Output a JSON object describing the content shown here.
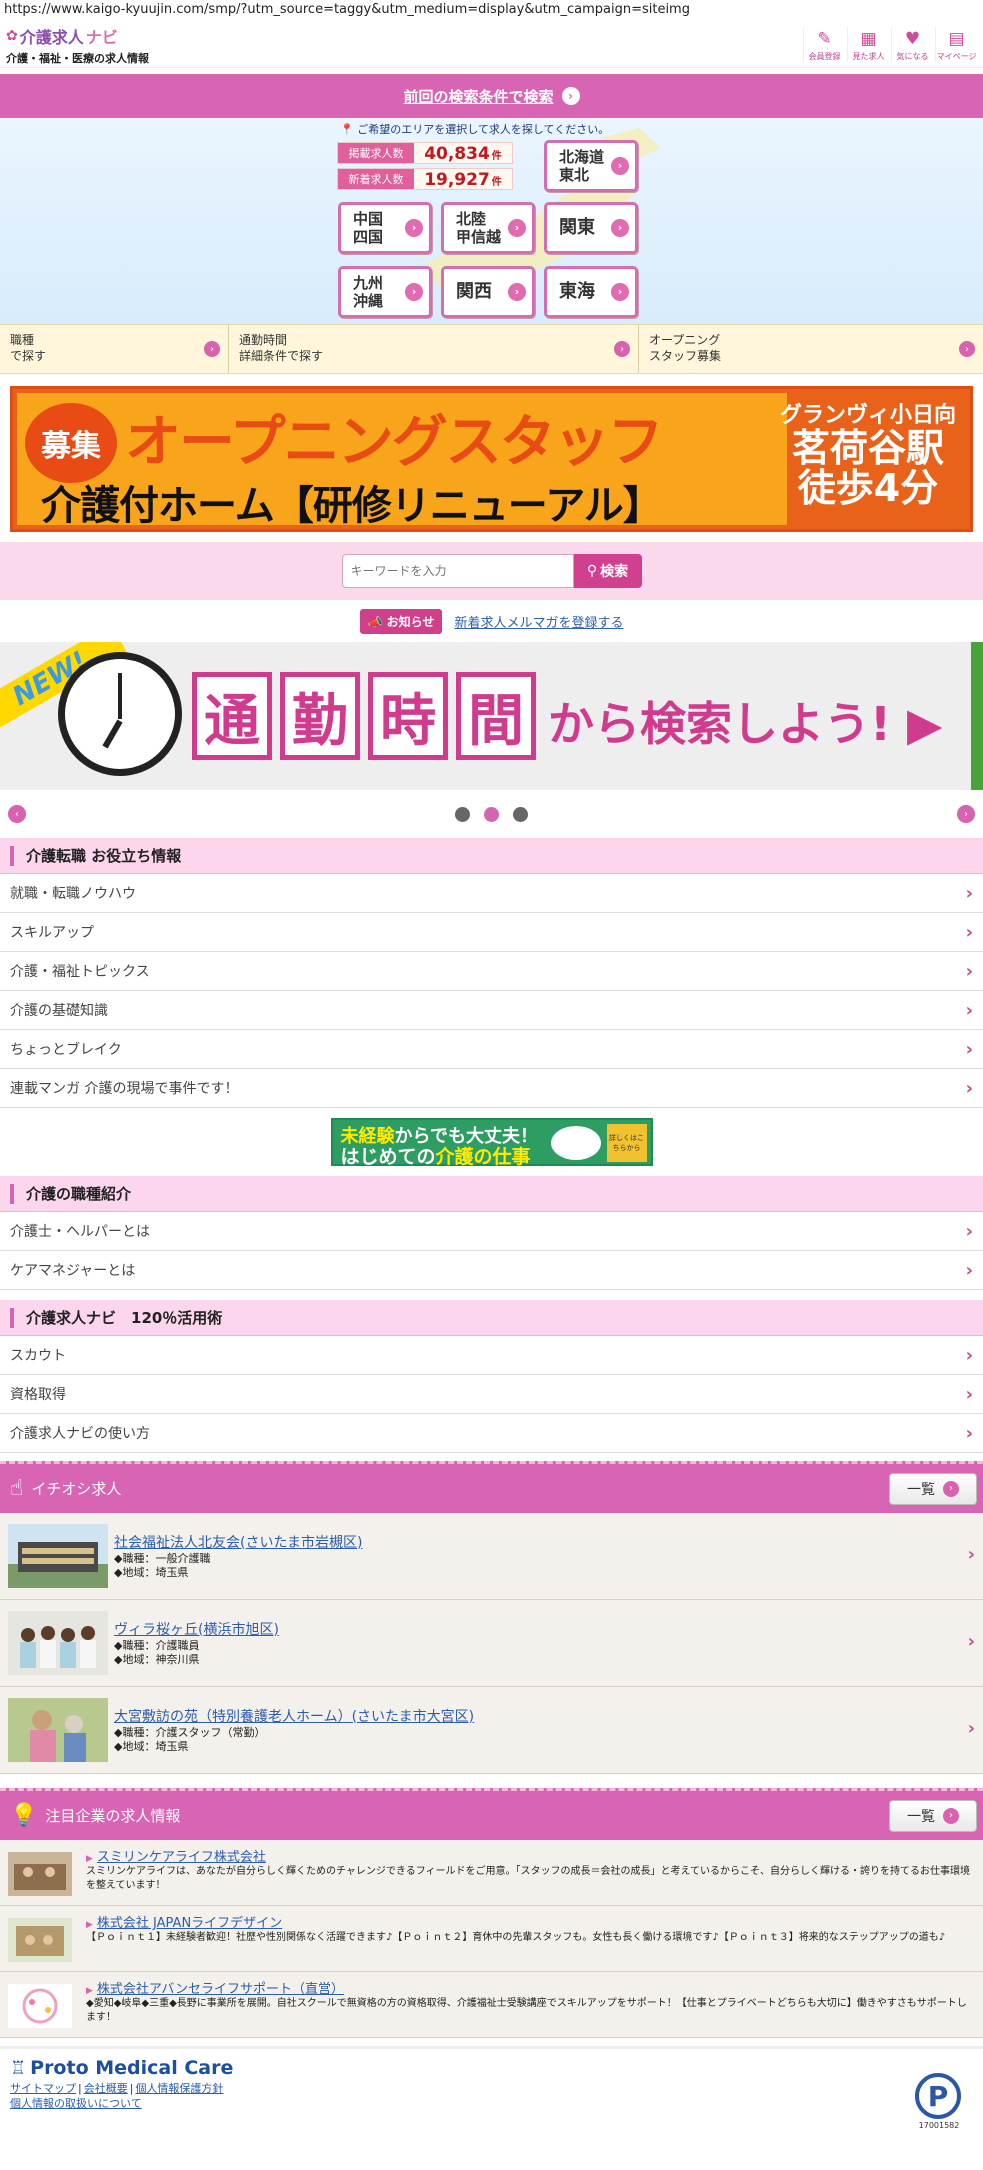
{
  "browser": {
    "url": "https://www.kaigo-kyuujin.com/smp/?utm_source=taggy&utm_medium=display&utm_campaign=siteimg"
  },
  "header": {
    "logo_main": "介護求人",
    "logo_navi": "ナビ",
    "logo_sub": "介護・福祉・医療の求人情報",
    "icons": [
      {
        "label": "会員登録",
        "icon": "pencil-icon"
      },
      {
        "label": "見た求人",
        "icon": "calendar-icon"
      },
      {
        "label": "気になる",
        "icon": "heart-icon"
      },
      {
        "label": "マイページ",
        "icon": "mypage-icon"
      }
    ]
  },
  "prev_search": {
    "label": "前回の検索条件で検索"
  },
  "map": {
    "hint": "ご希望のエリアを選択して求人を探してください。",
    "counts": [
      {
        "tag": "掲載求人数",
        "value": "40,834",
        "unit": "件"
      },
      {
        "tag": "新着求人数",
        "value": "19,927",
        "unit": "件"
      }
    ],
    "regions": {
      "hokkaido": {
        "line1": "北海道",
        "line2": "東北"
      },
      "chugoku": {
        "line1": "中国",
        "line2": "四国"
      },
      "hokuriku": {
        "line1": "北陸",
        "line2": "甲信越"
      },
      "kanto": "関東",
      "kyushu": {
        "line1": "九州",
        "line2": "沖縄"
      },
      "kansai": "関西",
      "tokai": "東海"
    }
  },
  "quick_links": [
    {
      "line1": "職種",
      "line2": "で探す"
    },
    {
      "line1": "通勤時間",
      "line2": "詳細条件で探す"
    },
    {
      "line1": "オープニング",
      "line2": "スタッフ募集"
    }
  ],
  "banner1": {
    "badge": "募集",
    "title": "オープニングスタッフ",
    "subtitle": "介護付ホーム【研修リニューアル】",
    "right_line1": "グランヴィ小日向",
    "right_line2": "茗荷谷駅",
    "right_line3": "徒歩4分"
  },
  "search": {
    "placeholder": "キーワードを入力",
    "button": "検索"
  },
  "notice": {
    "badge": "お知らせ",
    "link": "新着求人メルマガを登録する"
  },
  "banner2": {
    "ribbon": "NEW!",
    "boxes": [
      "通",
      "勤",
      "時",
      "間"
    ],
    "tail": "から検索しよう!"
  },
  "slider": {
    "dots": 3,
    "active": 1
  },
  "sections": [
    {
      "title": "介護転職 お役立ち情報",
      "items": [
        "就職・転職ノウハウ",
        "スキルアップ",
        "介護・福祉トピックス",
        "介護の基礎知識",
        "ちょっとブレイク",
        "連載マンガ 介護の現場で事件です！"
      ]
    },
    {
      "title": "介護の職種紹介",
      "items": [
        "介護士・ヘルパーとは",
        "ケアマネジャーとは"
      ]
    },
    {
      "title": "介護求人ナビ　120％活用術",
      "items": [
        "スカウト",
        "資格取得",
        "介護求人ナビの使い方"
      ]
    }
  ],
  "banner3": {
    "l1_hl": "未経験",
    "l1": "からでも大丈夫！",
    "l2a": "はじめての",
    "l2_hl": "介護の仕事",
    "badge": "詳しくはこちらから"
  },
  "pickup": {
    "title": "イチオシ求人",
    "list_button": "一覧",
    "jobs": [
      {
        "name": "社会福祉法人北友会(さいたま市岩槻区)",
        "job": "◆職種：一般介護職",
        "area": "◆地域：埼玉県"
      },
      {
        "name": "ヴィラ桜ヶ丘(横浜市旭区)",
        "job": "◆職種：介護職員",
        "area": "◆地域：神奈川県"
      },
      {
        "name": "大宮敷訪の苑（特別養護老人ホーム）(さいたま市大宮区)",
        "job": "◆職種：介護スタッフ（常勤）",
        "area": "◆地域：埼玉県"
      }
    ]
  },
  "companies": {
    "title": "注目企業の求人情報",
    "list_button": "一覧",
    "items": [
      {
        "name": "スミリンケアライフ株式会社",
        "desc": "スミリンケアライフは、あなたが自分らしく輝くためのチャレンジできるフィールドをご用意。「スタッフの成長＝会社の成長」と考えているからこそ、自分らしく輝ける・誇りを持てるお仕事環境を整えています！"
      },
      {
        "name": "株式会社 JAPANライフデザイン",
        "desc": "【Ｐｏｉｎｔ１】未経験者歓迎！社歴や性別関係なく活躍できます♪【Ｐｏｉｎｔ２】育休中の先輩スタッフも。女性も長く働ける環境です♪【Ｐｏｉｎｔ３】将来的なステップアップの道も♪"
      },
      {
        "name": "株式会社アバンセライフサポート（直営）",
        "desc": "◆愛知◆岐阜◆三重◆長野に事業所を展開。自社スクールで無資格の方の資格取得、介護福祉士受験講座でスキルアップをサポート！【仕事とプライベートどちらも大切に】働きやすさもサポートします！"
      }
    ]
  },
  "footer": {
    "brand": "Proto Medical Care",
    "links": [
      "サイトマップ",
      "会社概要",
      "個人情報保護方針",
      "個人情報の取扱いについて"
    ],
    "privacy_number": "17001582"
  }
}
